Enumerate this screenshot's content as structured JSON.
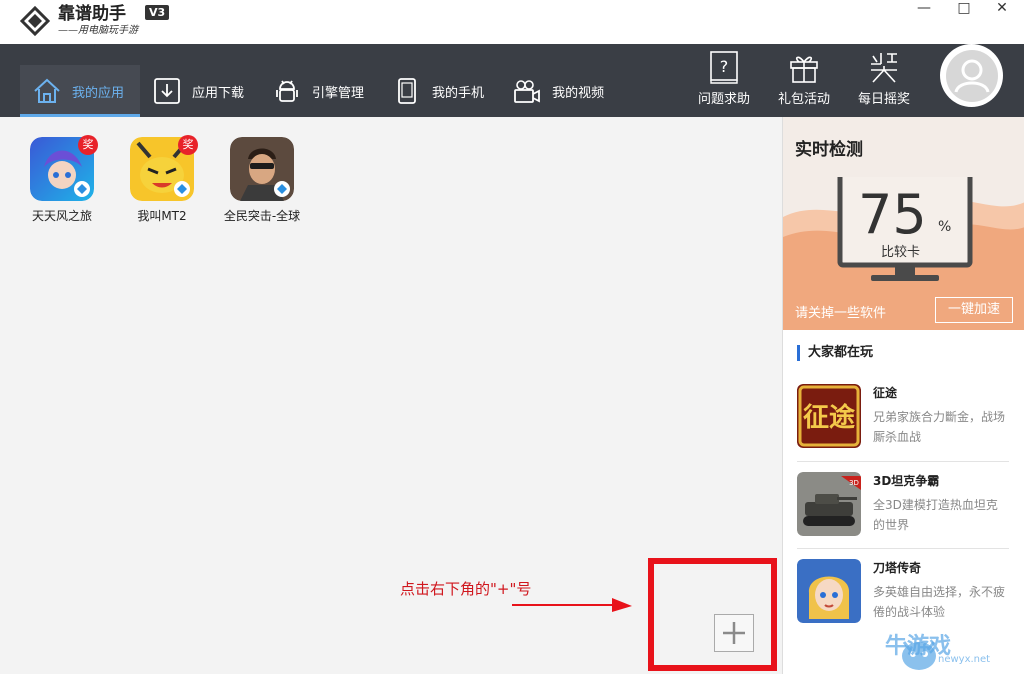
{
  "app": {
    "title": "靠谱助手",
    "subtitle": "——用电脑玩手游",
    "version": "V3"
  },
  "window_controls": [
    "—",
    "□",
    "✕"
  ],
  "nav": {
    "tabs": [
      {
        "label": "我的应用",
        "icon": "home-icon",
        "active": true
      },
      {
        "label": "应用下载",
        "icon": "download-icon",
        "active": false
      },
      {
        "label": "引擎管理",
        "icon": "android-icon",
        "active": false
      },
      {
        "label": "我的手机",
        "icon": "phone-icon",
        "active": false
      },
      {
        "label": "我的视频",
        "icon": "video-camera-icon",
        "active": false
      }
    ],
    "right_buttons": [
      {
        "label": "问题求助",
        "icon": "help-book-icon"
      },
      {
        "label": "礼包活动",
        "icon": "gift-icon"
      },
      {
        "label": "每日摇奖",
        "icon": "lottery-icon"
      }
    ]
  },
  "my_apps": [
    {
      "label": "天天风之旅",
      "badge": "奖"
    },
    {
      "label": "我叫MT2",
      "badge": "奖"
    },
    {
      "label": "全民突击-全球",
      "badge": ""
    }
  ],
  "annotation": {
    "hint": "点击右下角的\"+\"号"
  },
  "add_button": {
    "symbol": "+"
  },
  "monitor": {
    "title": "实时检测",
    "score": "75",
    "unit": "%",
    "grade": "比较卡",
    "hint": "请关掉一些软件",
    "boost_label": "一键加速"
  },
  "popular": {
    "title": "大家都在玩",
    "games": [
      {
        "name": "征途",
        "desc": "兄弟家族合力斷金，战场厮杀血战"
      },
      {
        "name": "3D坦克争霸",
        "desc": "全3D建模打造热血坦克的世界"
      },
      {
        "name": "刀塔传奇",
        "desc": "多英雄自由选择，永不疲倦的战斗体验"
      }
    ]
  },
  "watermark": {
    "text": "牛游戏",
    "sub": "newyx.net"
  },
  "colors": {
    "nav_bg": "#3a3e45",
    "active_accent": "#5fa8e8",
    "monitor_wave": "#f0a87e",
    "red_highlight": "#e8121a"
  }
}
